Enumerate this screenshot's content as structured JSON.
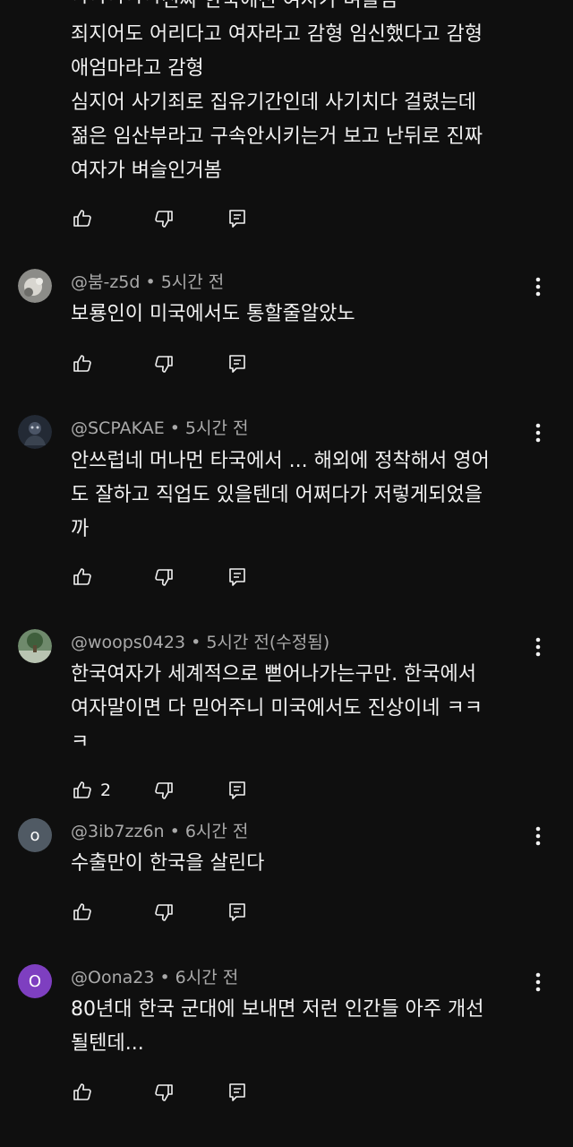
{
  "first_comment": {
    "text": "ㅋㅋㅋㅋㅋ진짜 한국에선 여자가 벼슬임\n죄지어도 어리다고 여자라고 감형  임신했다고 감형\n애엄마라고 감형\n심지어 사기죄로 집유기간인데 사기치다 걸렸는데\n젊은 임산부라고 구속안시키는거 보고 난뒤로 진짜\n여자가 벼슬인거봄",
    "like_count": ""
  },
  "comments": [
    {
      "handle": "@붐-z5d",
      "time": "5시간 전",
      "text": "보룡인이 미국에서도 통할줄알았노",
      "like_count": "",
      "avatar_color": "#9a9a96"
    },
    {
      "handle": "@SCPAKAE",
      "time": "5시간 전",
      "text": "안쓰럽네 머나먼 타국에서 ... 해외에 정착해서 영어\n도 잘하고 직업도 있을텐데 어쩌다가 저렇게되었을\n까",
      "like_count": "",
      "avatar_color": "#2c3340"
    },
    {
      "handle": "@woops0423",
      "time": "5시간 전(수정됨)",
      "text": "한국여자가 세계적으로 뻗어나가는구만. 한국에서\n여자말이면 다 믿어주니 미국에서도 진상이네 ㅋㅋ\nㅋ",
      "like_count": "2",
      "avatar_color": "#5b7a5a"
    },
    {
      "handle": "@3ib7zz6n",
      "time": "6시간 전",
      "text": "수출만이 한국을 살린다",
      "like_count": "",
      "avatar_letter": "o",
      "avatar_color": "#505a64"
    },
    {
      "handle": "@Oona23",
      "time": "6시간 전",
      "text": "80년대 한국 군대에 보내면 저런 인간들 아주 개선\n될텐데...",
      "like_count": "",
      "avatar_letter": "O",
      "avatar_color": "#7e3fc0"
    }
  ],
  "icons": {
    "like": "thumb-up-icon",
    "dislike": "thumb-down-icon",
    "reply": "reply-comment-icon",
    "more": "more-vertical-icon"
  }
}
